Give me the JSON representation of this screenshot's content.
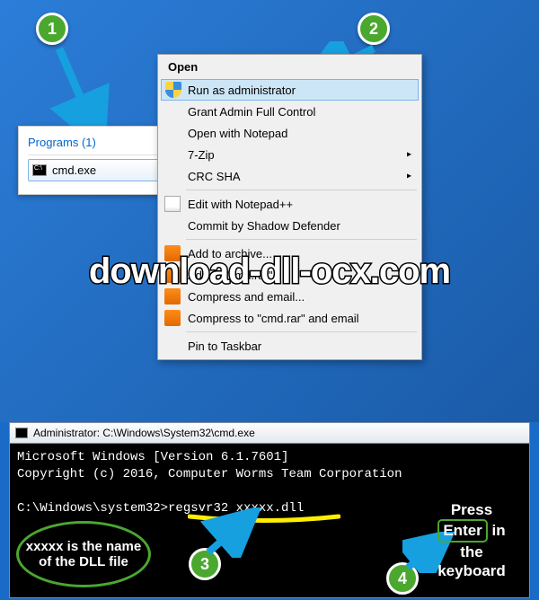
{
  "badges": {
    "b1": "1",
    "b2": "2",
    "b3": "3",
    "b4": "4"
  },
  "programs": {
    "header": "Programs (1)",
    "item1": "cmd.exe"
  },
  "menu": {
    "header": "Open",
    "runAdmin": "Run as administrator",
    "grantFull": "Grant Admin Full Control",
    "openNotepad": "Open with Notepad",
    "sevenZip": "7-Zip",
    "crcSha": "CRC SHA",
    "editNpp": "Edit with Notepad++",
    "commitShadow": "Commit by Shadow Defender",
    "addArchive": "Add to archive...",
    "addCmdRar": "Add to \"cmd.rar\"",
    "compressEmail": "Compress and email...",
    "compressCmdEmail": "Compress to \"cmd.rar\" and email",
    "pinTaskbar": "Pin to Taskbar"
  },
  "overlay": "download-dll-ocx.com",
  "cmd": {
    "title": "Administrator: C:\\Windows\\System32\\cmd.exe",
    "line1": "Microsoft Windows [Version 6.1.7601]",
    "line2": "Copyright (c) 2016, Computer Worms Team Corporation",
    "promptPath": "C:\\Windows\\system32>",
    "command": "regsvr32 xxxxx.dll"
  },
  "notes": {
    "dllNote": "xxxxx is the name of the DLL file",
    "pressL1": "Press",
    "enter": "Enter",
    "pressL2": "in the keyboard"
  }
}
